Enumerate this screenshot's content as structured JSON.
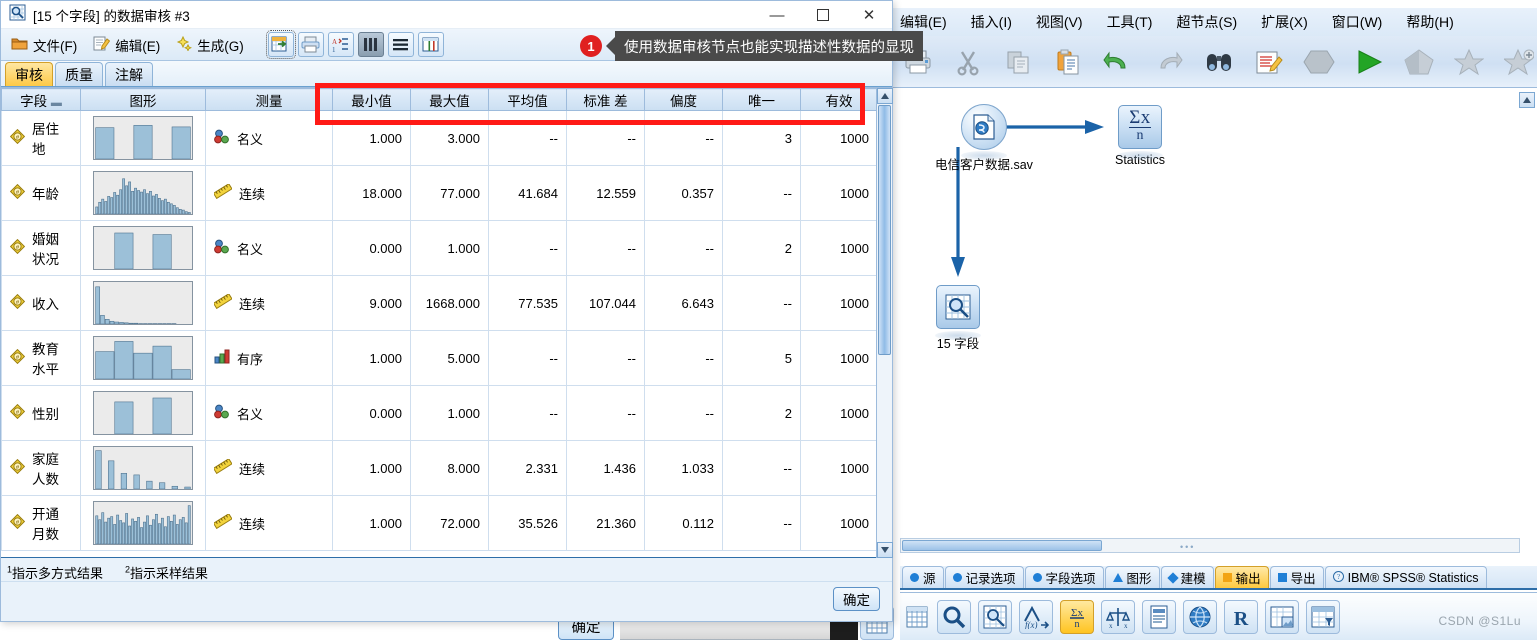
{
  "modeler": {
    "menu": [
      {
        "label": "编辑(E)",
        "mnemonic": "E"
      },
      {
        "label": "插入(I)",
        "mnemonic": "I"
      },
      {
        "label": "视图(V)",
        "mnemonic": "V"
      },
      {
        "label": "工具(T)",
        "mnemonic": "T"
      },
      {
        "label": "超节点(S)",
        "mnemonic": "S"
      },
      {
        "label": "扩展(X)",
        "mnemonic": "X"
      },
      {
        "label": "窗口(W)",
        "mnemonic": "W"
      },
      {
        "label": "帮助(H)",
        "mnemonic": "H"
      }
    ],
    "toolbar_icons": [
      "print-icon",
      "cut-icon",
      "copy-icon",
      "paste-icon",
      "undo-icon",
      "redo-icon",
      "find-icon",
      "edit-note-icon",
      "hexagon-icon",
      "run-play-icon",
      "pentagon-icon",
      "star-icon",
      "star-add-icon"
    ],
    "canvas": {
      "nodes": [
        {
          "name": "电信客户数据.sav",
          "type": "source-statistics-file-node",
          "icon": "statistics-file-icon"
        },
        {
          "name": "Statistics",
          "type": "statistics-output-node",
          "icon": "sigma-x-over-n-icon"
        },
        {
          "name": "15 字段",
          "type": "data-audit-node",
          "icon": "data-audit-magnifier-icon"
        }
      ]
    },
    "palette_tabs": [
      {
        "label": "源",
        "marker": "circle",
        "active": false
      },
      {
        "label": "记录选项",
        "marker": "circle",
        "active": false
      },
      {
        "label": "字段选项",
        "marker": "circle",
        "active": false
      },
      {
        "label": "图形",
        "marker": "tri",
        "active": false
      },
      {
        "label": "建模",
        "marker": "diam",
        "active": false
      },
      {
        "label": "输出",
        "marker": "sq",
        "active": true
      },
      {
        "label": "导出",
        "marker": "sqb",
        "active": false
      },
      {
        "label": "IBM® SPSS® Statistics",
        "marker": "circle-q",
        "active": false
      }
    ],
    "palette_items": [
      {
        "icon": "table-icon",
        "selected": false
      },
      {
        "icon": "magnifier-icon",
        "selected": false
      },
      {
        "icon": "data-audit-icon",
        "selected": false
      },
      {
        "icon": "transform-fx-icon",
        "selected": false
      },
      {
        "icon": "statistics-sigma-icon",
        "selected": true
      },
      {
        "icon": "means-balance-icon",
        "selected": false
      },
      {
        "icon": "report-icon",
        "selected": false
      },
      {
        "icon": "globe-icon",
        "selected": false
      },
      {
        "icon": "r-output-icon",
        "selected": false
      },
      {
        "icon": "table-image-icon",
        "selected": false
      },
      {
        "icon": "table-filter-icon",
        "selected": false
      }
    ],
    "watermark": "CSDN @S1Lu"
  },
  "callout": {
    "number": "1",
    "text": "使用数据审核节点也能实现描述性数据的显现"
  },
  "dialog": {
    "title": "[15 个字段] 的数据审核 #3",
    "title_icon": "data-audit-icon",
    "window_buttons": {
      "minimize": "—",
      "maximize": "❐",
      "close": "✕"
    },
    "menus": [
      {
        "label": "文件(F)",
        "icon": "file-icon"
      },
      {
        "label": "编辑(E)",
        "icon": "edit-icon"
      },
      {
        "label": "生成(G)",
        "icon": "generate-icon"
      }
    ],
    "toolbuttons": [
      {
        "icon": "export-grid-icon",
        "state": "focused"
      },
      {
        "icon": "print-icon",
        "state": "normal"
      },
      {
        "icon": "sort-az-icon",
        "state": "normal"
      },
      {
        "icon": "columns-icon",
        "state": "pressed"
      },
      {
        "icon": "list-lines-icon",
        "state": "normal"
      },
      {
        "icon": "display-table-icon",
        "state": "normal"
      }
    ],
    "tabs": [
      {
        "label": "审核",
        "active": true
      },
      {
        "label": "质量",
        "active": false
      },
      {
        "label": "注解",
        "active": false
      }
    ],
    "table": {
      "headers": [
        "字段",
        "图形",
        "测量",
        "最小值",
        "最大值",
        "平均值",
        "标准 差",
        "偏度",
        "唯一",
        "有效"
      ],
      "rows": [
        {
          "field": "居住地",
          "field_icon": "continuous-field-icon",
          "measure": "名义",
          "measure_icon": "nominal-icon",
          "chart": [
            0.8,
            0.0,
            0.86,
            0.0,
            0.82
          ],
          "min": "1.000",
          "max": "3.000",
          "mean": "--",
          "stddev": "--",
          "skew": "--",
          "unique": "3",
          "valid": "1000"
        },
        {
          "field": "年龄",
          "field_icon": "continuous-field-icon",
          "measure": "连续",
          "measure_icon": "continuous-icon",
          "chart": [
            0.18,
            0.3,
            0.38,
            0.32,
            0.45,
            0.42,
            0.55,
            0.48,
            0.62,
            0.9,
            0.72,
            0.82,
            0.58,
            0.66,
            0.6,
            0.56,
            0.62,
            0.52,
            0.58,
            0.46,
            0.5,
            0.4,
            0.34,
            0.38,
            0.3,
            0.26,
            0.22,
            0.16,
            0.12,
            0.1,
            0.06,
            0.04
          ],
          "min": "18.000",
          "max": "77.000",
          "mean": "41.684",
          "stddev": "12.559",
          "skew": "0.357",
          "unique": "--",
          "valid": "1000"
        },
        {
          "field": "婚姻状况",
          "field_icon": "continuous-field-icon",
          "measure": "名义",
          "measure_icon": "nominal-icon",
          "chart": [
            0.0,
            0.92,
            0.0,
            0.88,
            0.0
          ],
          "min": "0.000",
          "max": "1.000",
          "mean": "--",
          "stddev": "--",
          "skew": "--",
          "unique": "2",
          "valid": "1000"
        },
        {
          "field": "收入",
          "field_icon": "continuous-field-icon",
          "measure": "连续",
          "measure_icon": "continuous-icon",
          "chart": [
            0.95,
            0.22,
            0.12,
            0.07,
            0.05,
            0.04,
            0.03,
            0.02,
            0.02,
            0.01,
            0.01,
            0.01,
            0.01,
            0.01,
            0.01,
            0.01,
            0.01,
            0.0,
            0.0,
            0.0
          ],
          "min": "9.000",
          "max": "1668.000",
          "mean": "77.535",
          "stddev": "107.044",
          "skew": "6.643",
          "unique": "--",
          "valid": "1000"
        },
        {
          "field": "教育水平",
          "field_icon": "continuous-field-icon",
          "measure": "有序",
          "measure_icon": "ordinal-icon",
          "chart": [
            0.7,
            0.96,
            0.66,
            0.84,
            0.24
          ],
          "min": "1.000",
          "max": "5.000",
          "mean": "--",
          "stddev": "--",
          "skew": "--",
          "unique": "5",
          "valid": "1000"
        },
        {
          "field": "性别",
          "field_icon": "continuous-field-icon",
          "measure": "名义",
          "measure_icon": "nominal-icon",
          "chart": [
            0.0,
            0.82,
            0.0,
            0.92,
            0.0
          ],
          "min": "0.000",
          "max": "1.000",
          "mean": "--",
          "stddev": "--",
          "skew": "--",
          "unique": "2",
          "valid": "1000"
        },
        {
          "field": "家庭人数",
          "field_icon": "continuous-field-icon",
          "measure": "连续",
          "measure_icon": "continuous-icon",
          "chart": [
            0.98,
            0.0,
            0.72,
            0.0,
            0.4,
            0.0,
            0.36,
            0.0,
            0.2,
            0.0,
            0.16,
            0.0,
            0.07,
            0.0,
            0.05
          ],
          "min": "1.000",
          "max": "8.000",
          "mean": "2.331",
          "stddev": "1.436",
          "skew": "1.033",
          "unique": "--",
          "valid": "1000"
        },
        {
          "field": "开通月数",
          "field_icon": "continuous-field-icon",
          "measure": "连续",
          "measure_icon": "continuous-icon",
          "chart": [
            0.72,
            0.62,
            0.8,
            0.56,
            0.66,
            0.7,
            0.5,
            0.74,
            0.6,
            0.54,
            0.78,
            0.46,
            0.64,
            0.58,
            0.68,
            0.42,
            0.56,
            0.72,
            0.48,
            0.62,
            0.76,
            0.52,
            0.66,
            0.44,
            0.7,
            0.58,
            0.74,
            0.5,
            0.62,
            0.68,
            0.54,
            0.98
          ],
          "min": "1.000",
          "max": "72.000",
          "mean": "35.526",
          "stddev": "21.360",
          "skew": "0.112",
          "unique": "--",
          "valid": "1000"
        }
      ]
    },
    "footnotes": [
      {
        "marker": "1",
        "text": "指示多方式结果"
      },
      {
        "marker": "2",
        "text": "指示采样结果"
      }
    ],
    "ok_label": "确定"
  },
  "background_dialog": {
    "ok_label": "确定"
  }
}
